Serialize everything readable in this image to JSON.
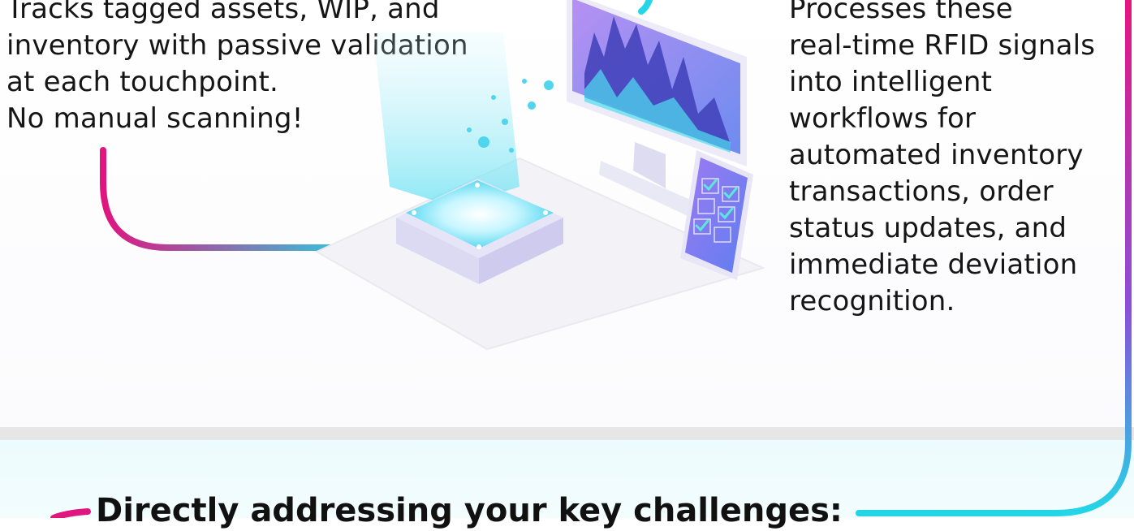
{
  "left_text": {
    "lines": [
      "Tracks tagged assets, WIP, and",
      "inventory with passive validation",
      "at each touchpoint.",
      "No manual scanning!"
    ]
  },
  "right_text": {
    "lines": [
      "Processes these",
      "real-time RFID signals",
      "into intelligent",
      "workflows for",
      "automated inventory",
      "transactions, order",
      "status updates, and",
      "immediate deviation",
      "recognition."
    ]
  },
  "section_heading": "Directly addressing your key challenges:",
  "colors": {
    "magenta": "#e0157f",
    "cyan": "#22d6e6",
    "purple": "#7b5cf0",
    "divider": "#e6e6e6"
  },
  "icons": [
    "rfid-reader-icon",
    "monitor-chart-icon",
    "smartphone-checklist-icon"
  ]
}
